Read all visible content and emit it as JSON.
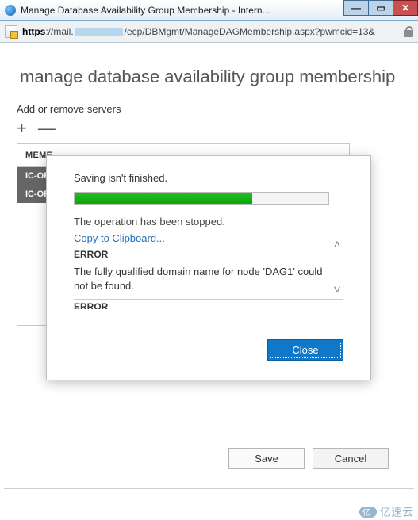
{
  "window": {
    "title": "Manage Database Availability Group Membership - Intern..."
  },
  "address": {
    "scheme": "https",
    "host_prefix": "://mail.",
    "host_hidden": true,
    "path": "/ecp/DBMgmt/ManageDAGMembership.aspx?pwmcid=13&"
  },
  "page": {
    "title": "manage database availability group membership",
    "section_label": "Add or remove servers",
    "add_icon_label": "add",
    "remove_icon_label": "remove",
    "table": {
      "header": "MEMBER SERVERS",
      "header_truncated": "MEME",
      "rows": [
        "IC-OR",
        "IC-OR"
      ]
    },
    "save_label": "Save",
    "cancel_label": "Cancel"
  },
  "modal": {
    "status_title": "Saving isn't finished.",
    "progress_percent": 70,
    "stopped_text": "The operation has been stopped.",
    "copy_link": "Copy to Clipboard...",
    "error_heading": "ERROR",
    "error_message": "The fully qualified domain name for node 'DAG1' could not be found.",
    "error_heading_cut": "ERROR",
    "close_label": "Close"
  },
  "watermark": "亿速云"
}
